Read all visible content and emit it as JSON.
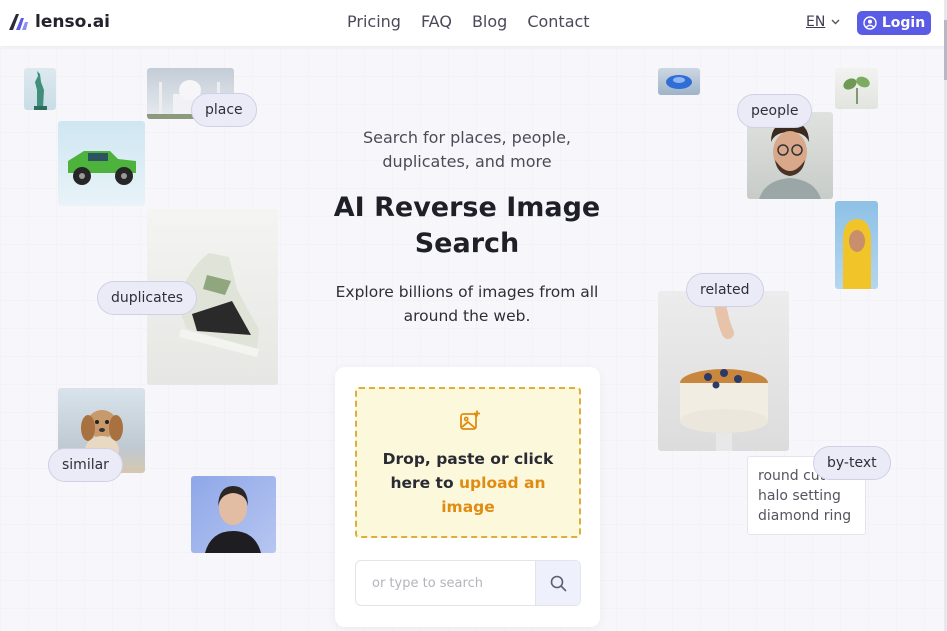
{
  "brand": {
    "name": "lenso.ai"
  },
  "nav": {
    "items": [
      "Pricing",
      "FAQ",
      "Blog",
      "Contact"
    ]
  },
  "header": {
    "language": "EN",
    "login_label": "Login"
  },
  "hero": {
    "subtitle_line1": "Search for places, people,",
    "subtitle_line2": "duplicates, and more",
    "title_line1": "AI Reverse Image",
    "title_line2": "Search",
    "description_line1": "Explore billions of images from all",
    "description_line2": "around the web."
  },
  "upload": {
    "line1": "Drop, paste or click",
    "line2_prefix": "here to ",
    "link_part1": "upload an",
    "link_part2": "image",
    "accent_color": "#e08b12"
  },
  "search": {
    "placeholder": "or type to search"
  },
  "tags": {
    "place": "place",
    "duplicates": "duplicates",
    "similar": "similar",
    "people": "people",
    "related": "related",
    "by_text": "by-text"
  },
  "text_example": {
    "lines": [
      "round cut",
      "halo setting",
      "diamond ring"
    ]
  },
  "colors": {
    "brand": "#5b5ce6",
    "drop_bg": "#fcf8dc",
    "drop_border": "#dcae3c"
  },
  "icons": [
    "logo-icon",
    "chevron-down-icon",
    "user-icon",
    "image-plus-icon",
    "search-icon"
  ]
}
